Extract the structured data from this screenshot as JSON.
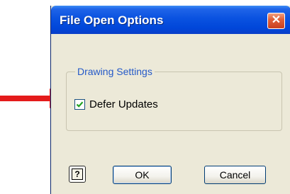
{
  "dialog": {
    "title": "File Open Options",
    "close_glyph": "✕",
    "group": {
      "legend": "Drawing Settings",
      "checkbox": {
        "label": "Defer Updates",
        "checked": true
      }
    },
    "buttons": {
      "help_glyph": "?",
      "ok_label": "OK",
      "cancel_label": "Cancel"
    }
  },
  "annotation": {
    "arrow_color": "#e41b1b",
    "icon": "arrow-right-icon"
  },
  "colors": {
    "titlebar": "#0a52e0",
    "dialog_bg": "#ece9d8",
    "legend_text": "#2459c8",
    "close_button": "#e0603a"
  }
}
